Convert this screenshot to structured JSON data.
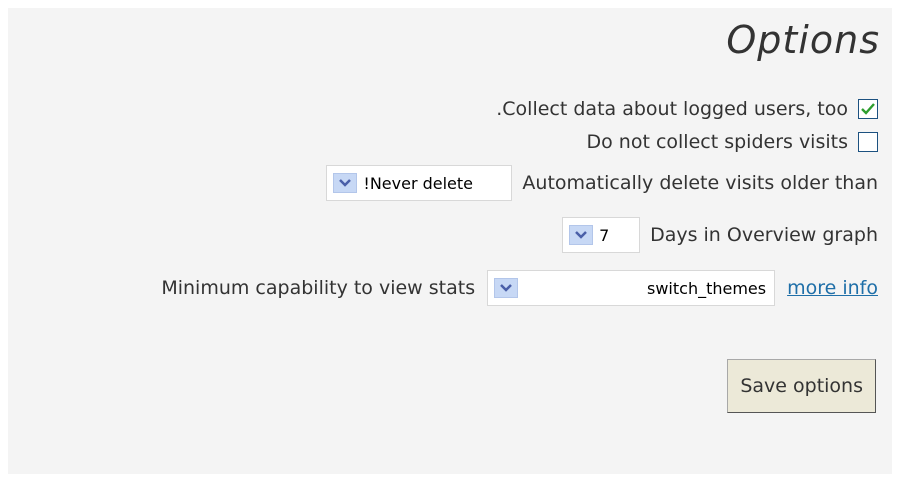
{
  "options": {
    "title": "Options",
    "collect_logged_users_label": ".Collect data about logged users, too",
    "collect_logged_users_checked": true,
    "no_spiders_label": "Do not collect spiders visits",
    "no_spiders_checked": false,
    "auto_delete_label": "Automatically delete visits older than",
    "auto_delete_value": "!Never delete",
    "days_graph_label": "Days in Overview graph",
    "days_graph_value": "7",
    "min_capability_label": "Minimum capability to view stats",
    "min_capability_value": "switch_themes",
    "more_info_link": "more info",
    "save_button": "Save options"
  },
  "colors": {
    "panel_bg": "#f4f4f4",
    "checkbox_check": "#2e9e2e",
    "link": "#1f6fa8",
    "button_bg": "#ece9d8",
    "dropdown_arrow_bg": "#c7d8f5"
  },
  "icons": {
    "checkbox_checked": "check-icon",
    "dropdown": "chevron-down-icon"
  }
}
